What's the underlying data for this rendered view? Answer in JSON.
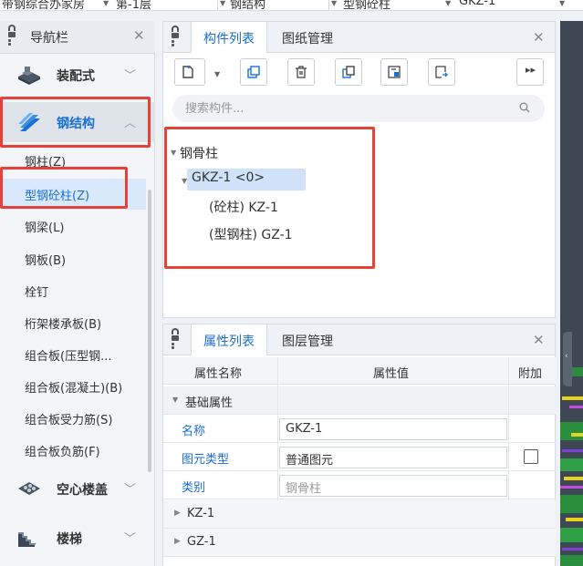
{
  "topbar": {
    "item1": "带钢综合办家房",
    "item2": "第-1层",
    "item3": "钢结构",
    "item4": "型钢砼柱",
    "item5": "GKZ-1"
  },
  "nav": {
    "title": "导航栏",
    "categories": [
      {
        "label": "装配式",
        "icon": "prefab-icon"
      },
      {
        "label": "钢结构",
        "icon": "steel-structure-icon"
      },
      {
        "label": "空心楼盖",
        "icon": "hollow-floor-icon"
      },
      {
        "label": "楼梯",
        "icon": "stairs-icon"
      }
    ],
    "items": [
      "钢柱(Z)",
      "型钢砼柱(Z)",
      "钢梁(L)",
      "钢板(B)",
      "栓钉",
      "桁架楼承板(B)",
      "组合板(压型钢...",
      "组合板(混凝土)(B)",
      "组合板受力筋(S)",
      "组合板负筋(F)"
    ]
  },
  "component_panel": {
    "tabs": [
      "构件列表",
      "图纸管理"
    ],
    "search_placeholder": "搜索构件...",
    "tree": {
      "root": "钢骨柱",
      "node": "GKZ-1 <0>",
      "children": [
        "(砼柱) KZ-1",
        "(型钢柱) GZ-1"
      ]
    }
  },
  "property_panel": {
    "tabs": [
      "属性列表",
      "图层管理"
    ],
    "headers": {
      "name": "属性名称",
      "value": "属性值",
      "extra": "附加"
    },
    "group": "基础属性",
    "rows": [
      {
        "name": "名称",
        "value": "GKZ-1"
      },
      {
        "name": "图元类型",
        "value": "普通图元"
      },
      {
        "name": "类别",
        "value": "钢骨柱"
      }
    ],
    "subgroups": [
      "KZ-1",
      "GZ-1"
    ]
  },
  "colors": {
    "accent": "#1a6fd1",
    "highlight_box": "#e8413a",
    "selected_bg": "#cfe2fa"
  }
}
